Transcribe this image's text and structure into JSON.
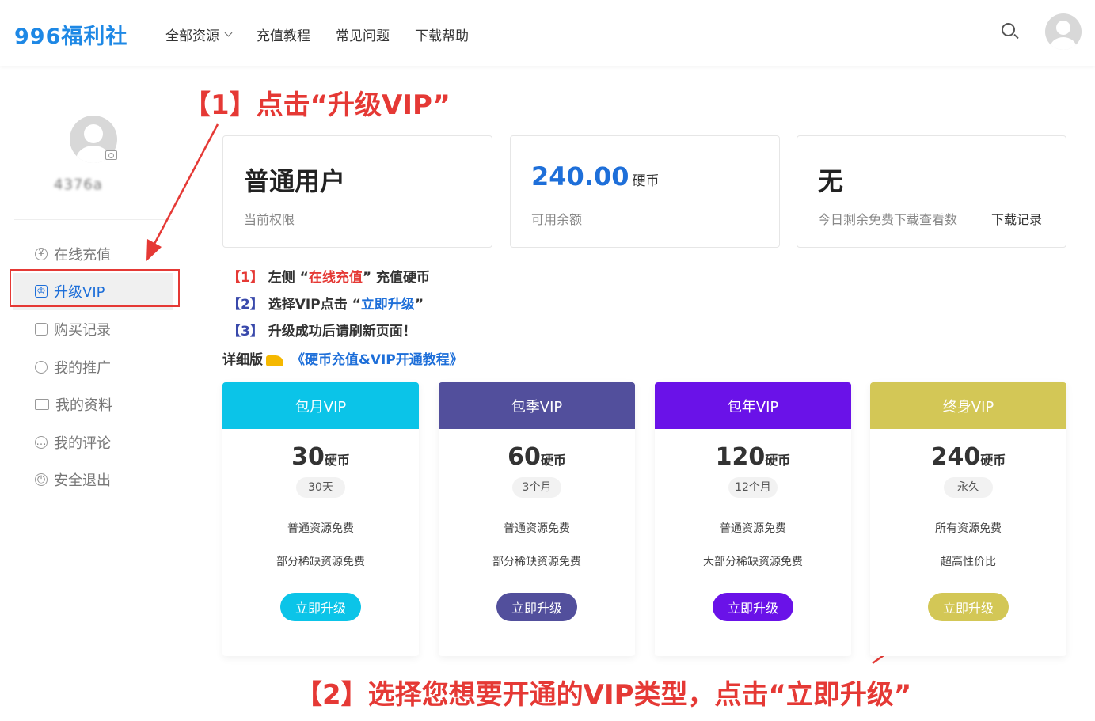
{
  "header": {
    "logo": "996福利社",
    "nav": [
      "全部资源",
      "充值教程",
      "常见问题",
      "下载帮助"
    ]
  },
  "sidebar": {
    "username": "4376a",
    "items": [
      {
        "label": "在线充值",
        "icon": "yen-icon"
      },
      {
        "label": "升级VIP",
        "icon": "crown-icon"
      },
      {
        "label": "购买记录",
        "icon": "bag-icon"
      },
      {
        "label": "我的推广",
        "icon": "circle-icon"
      },
      {
        "label": "我的资料",
        "icon": "id-card-icon"
      },
      {
        "label": "我的评论",
        "icon": "comment-icon"
      },
      {
        "label": "安全退出",
        "icon": "power-icon"
      }
    ]
  },
  "annotations": {
    "step1": "【1】点击“升级VIP”",
    "step2": "【2】选择您想要开通的VIP类型，点击“立即升级”"
  },
  "stats": {
    "level": {
      "value": "普通用户",
      "label": "当前权限"
    },
    "balance": {
      "value": "240.00",
      "unit": "硬币",
      "label": "可用余额"
    },
    "downloads": {
      "value": "无",
      "label": "今日剩余免费下载查看数",
      "link": "下载记录"
    }
  },
  "instructions": {
    "s1_num": "【1】",
    "s1_a": "左侧 “",
    "s1_b": "在线充值",
    "s1_c": "” 充值硬币",
    "s2_num": "【2】",
    "s2_a": "选择VIP点击 “",
    "s2_b": "立即升级",
    "s2_c": "”",
    "s3_num": "【3】",
    "s3_a": "升级成功后请刷新页面！",
    "detail_label": "详细版",
    "detail_link": "《硬币充值&VIP开通教程》"
  },
  "plans": [
    {
      "name": "包月VIP",
      "price": "30",
      "currency": "硬币",
      "duration": "30天",
      "feature1": "普通资源免费",
      "feature2": "部分稀缺资源免费",
      "button": "立即升级",
      "color": "#0bc4e8"
    },
    {
      "name": "包季VIP",
      "price": "60",
      "currency": "硬币",
      "duration": "3个月",
      "feature1": "普通资源免费",
      "feature2": "部分稀缺资源免费",
      "button": "立即升级",
      "color": "#524f9c"
    },
    {
      "name": "包年VIP",
      "price": "120",
      "currency": "硬币",
      "duration": "12个月",
      "feature1": "普通资源免费",
      "feature2": "大部分稀缺资源免费",
      "button": "立即升级",
      "color": "#6a12e8"
    },
    {
      "name": "终身VIP",
      "price": "240",
      "currency": "硬币",
      "duration": "永久",
      "feature1": "所有资源免费",
      "feature2": "超高性价比",
      "button": "立即升级",
      "color": "#d3c756"
    }
  ]
}
